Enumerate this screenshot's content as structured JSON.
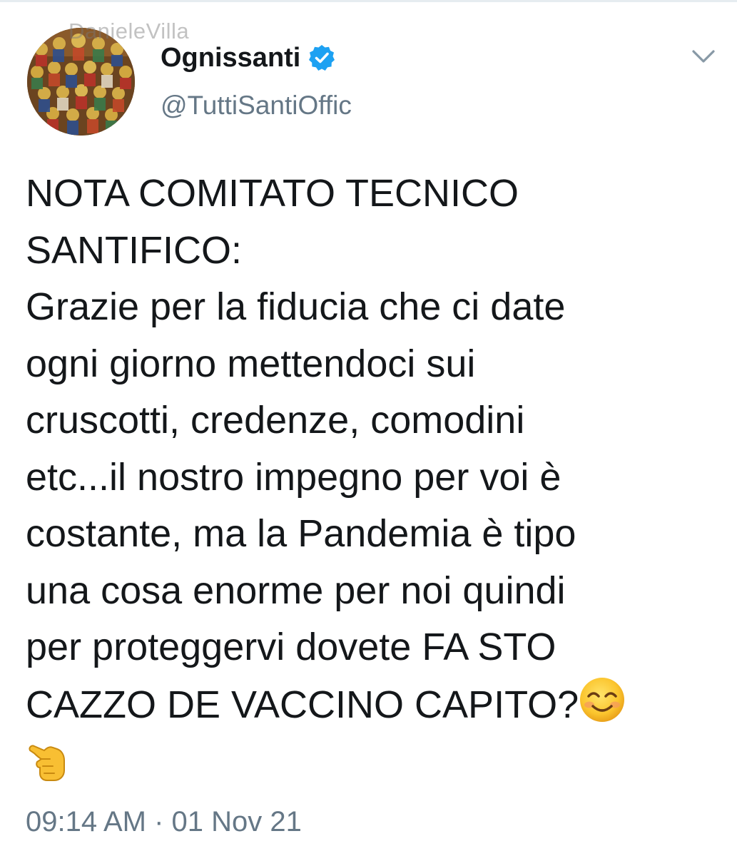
{
  "watermark": "DanieleVilla",
  "author": {
    "display_name": "Ognissanti",
    "handle": "@TuttiSantiOffic",
    "verified": true,
    "avatar_icon": "saints-painting-avatar"
  },
  "tweet": {
    "lines": [
      "NOTA COMITATO TECNICO",
      "SANTIFICO:",
      "Grazie per la fiducia che ci date",
      "ogni giorno mettendoci sui",
      "cruscotti, credenze, comodini",
      "etc...il nostro impegno per voi è",
      "costante, ma la Pandemia è tipo",
      "una cosa enorme per noi quindi",
      "per proteggervi dovete FA STO",
      "CAZZO DE VACCINO CAPITO?"
    ],
    "emojis": [
      "smiling-face-emoji",
      "hand-pointing-left-emoji"
    ]
  },
  "timestamp": "09:14 AM · 01 Nov 21",
  "colors": {
    "text": "#14171a",
    "secondary": "#657786",
    "verified_blue": "#1da1f2"
  }
}
